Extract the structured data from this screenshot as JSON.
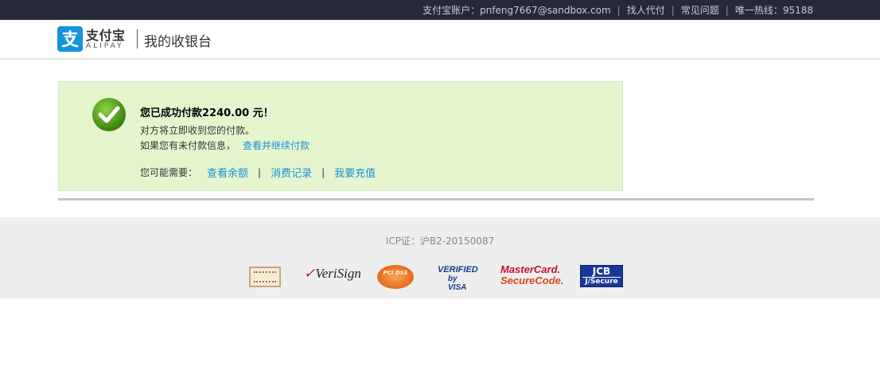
{
  "topbar": {
    "account_label": "支付宝账户：pnfeng7667@sandbox.com",
    "separator": "|",
    "links": [
      "找人代付",
      "常见问题"
    ],
    "hotline": "唯一热线：95188"
  },
  "header": {
    "brand_cn": "支付宝",
    "brand_en": "ALIPAY",
    "title": "我的收银台"
  },
  "success": {
    "title": "您已成功付款2240.00 元！",
    "line2": "对方将立即收到您的付款。",
    "line3_text": "如果您有未付款信息，",
    "line3_link": "查看并继续付款",
    "maybe_label": "您可能需要：",
    "actions": [
      "查看余额",
      "消费记录",
      "我要充值"
    ],
    "action_separator": "|"
  },
  "footer": {
    "icp": "ICP证：沪B2-20150087",
    "badges": {
      "verisign": "VeriSign",
      "pci": "PCI DSS",
      "visa_line1": "VERIFIED",
      "visa_line2": "by VISA",
      "mastercard_line1": "MasterCard.",
      "mastercard_line2": "SecureCode.",
      "jcb_line1": "JCB",
      "jcb_line2": "J/Secure"
    }
  },
  "colors": {
    "topbar_bg": "#262936",
    "brand_blue": "#1296db",
    "success_bg": "#e5f6cf",
    "success_border": "#d6e6be",
    "link": "#1a8fd6",
    "check_green": "#5aa51c",
    "footer_bg": "#eeeeee"
  }
}
